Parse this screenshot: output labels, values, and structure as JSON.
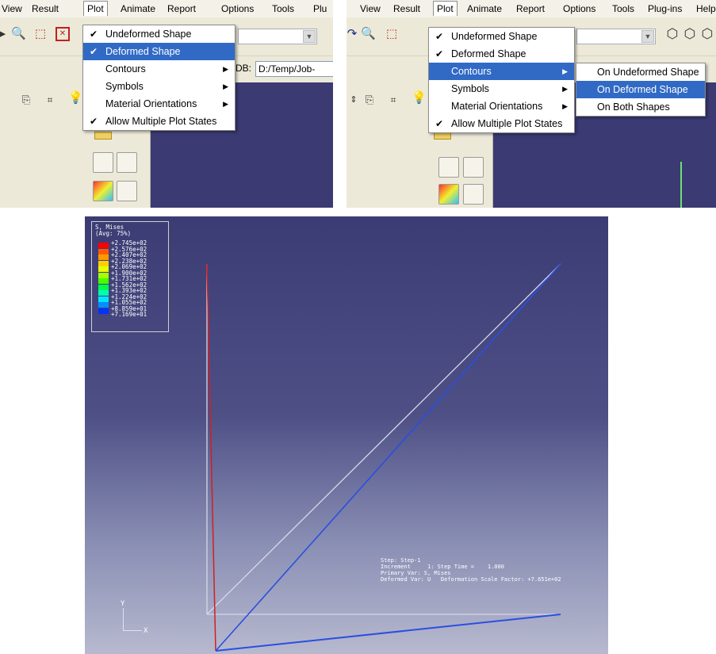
{
  "left_panel": {
    "menubar": [
      "View",
      "Result",
      "Plot",
      "Animate",
      "Report",
      "Options",
      "Tools",
      "Plu"
    ],
    "plot_menu": [
      {
        "label": "Undeformed Shape",
        "checked": true,
        "submenu": false,
        "highlighted": false
      },
      {
        "label": "Deformed Shape",
        "checked": true,
        "submenu": false,
        "highlighted": true
      },
      {
        "label": "Contours",
        "checked": false,
        "submenu": true,
        "highlighted": false
      },
      {
        "label": "Symbols",
        "checked": false,
        "submenu": true,
        "highlighted": false
      },
      {
        "label": "Material Orientations",
        "checked": false,
        "submenu": true,
        "highlighted": false
      },
      {
        "label": "Allow Multiple Plot States",
        "checked": true,
        "submenu": false,
        "highlighted": false
      }
    ],
    "odb_label": "DB:",
    "odb_path": "D:/Temp/Job-"
  },
  "right_panel": {
    "menubar": [
      "View",
      "Result",
      "Plot",
      "Animate",
      "Report",
      "Options",
      "Tools",
      "Plug-ins",
      "Help"
    ],
    "plot_menu": [
      {
        "label": "Undeformed Shape",
        "checked": true,
        "submenu": false,
        "highlighted": false
      },
      {
        "label": "Deformed Shape",
        "checked": true,
        "submenu": false,
        "highlighted": false
      },
      {
        "label": "Contours",
        "checked": false,
        "submenu": true,
        "highlighted": true
      },
      {
        "label": "Symbols",
        "checked": false,
        "submenu": true,
        "highlighted": false
      },
      {
        "label": "Material Orientations",
        "checked": false,
        "submenu": true,
        "highlighted": false
      },
      {
        "label": "Allow Multiple Plot States",
        "checked": true,
        "submenu": false,
        "highlighted": false
      }
    ],
    "contours_submenu": [
      {
        "label": "On Undeformed Shape",
        "highlighted": false
      },
      {
        "label": "On Deformed Shape",
        "highlighted": true
      },
      {
        "label": "On Both Shapes",
        "highlighted": false
      }
    ]
  },
  "render": {
    "legend_title": "S, Mises",
    "legend_subtitle": "(Avg: 75%)",
    "legend_values": [
      "+2.745e+02",
      "+2.576e+02",
      "+2.407e+02",
      "+2.238e+02",
      "+2.069e+02",
      "+1.900e+02",
      "+1.731e+02",
      "+1.562e+02",
      "+1.393e+02",
      "+1.224e+02",
      "+1.055e+02",
      "+8.859e+01",
      "+7.169e+01"
    ],
    "legend_colors": [
      "#ff0000",
      "#ff5a00",
      "#ff9900",
      "#ffd000",
      "#e6ff00",
      "#a6ff00",
      "#48ff00",
      "#00ff48",
      "#00ffb0",
      "#00e4ff",
      "#0090ff",
      "#0033ff"
    ],
    "info_lines": [
      "Step: Step-1",
      "Increment     1: Step Time =    1.000",
      "Primary Var: S, Mises",
      "Deformed Var: U   Deformation Scale Factor: +7.651e+02"
    ],
    "triad_y": "Y",
    "triad_x": "X"
  },
  "colors": {
    "menu_highlight": "#316ac5",
    "viewport_top": "#3c3c74",
    "viewport_bottom": "#b7b9cf",
    "undeformed_line": "#d8d8e8",
    "deformed_blue": "#2a4fe0",
    "deformed_red": "#d02020"
  }
}
